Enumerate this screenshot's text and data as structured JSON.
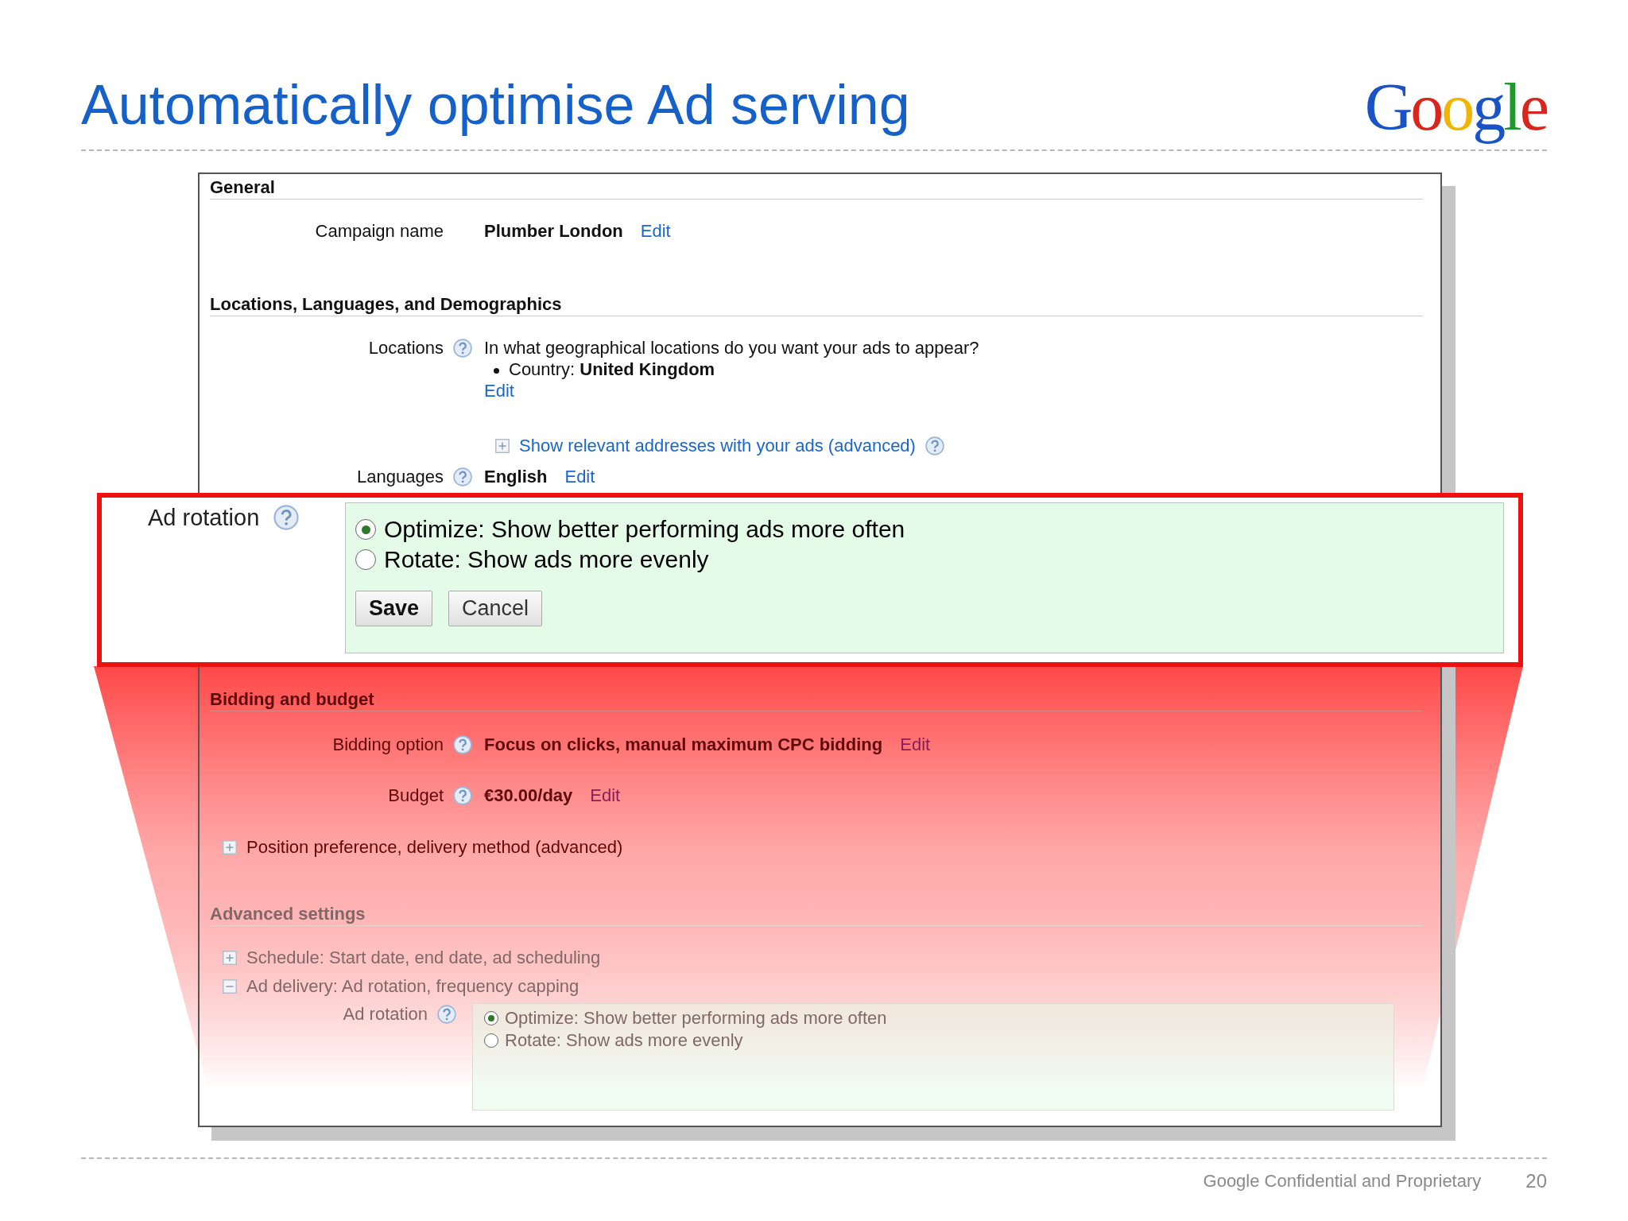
{
  "slide": {
    "title": "Automatically optimise Ad serving",
    "logo": "Google",
    "footer": "Google Confidential and Proprietary",
    "page_number": "20"
  },
  "sections": [
    {
      "heading": "General",
      "rows": [
        {
          "kind": "field",
          "label": "Campaign name",
          "help": false,
          "value": "Plumber London",
          "link": "Edit"
        }
      ]
    },
    {
      "heading": "Locations, Languages, and Demographics",
      "rows": [
        {
          "kind": "field",
          "label": "Locations",
          "help": true,
          "question": "In what geographical locations do you want your ads to appear?",
          "bullet_label": "Country:",
          "bullet_value": "United Kingdom",
          "link": "Edit"
        },
        {
          "kind": "expander",
          "text": "Show relevant addresses with your ads (advanced)",
          "linked": true,
          "expanded": false,
          "help": true
        },
        {
          "kind": "field",
          "label": "Languages",
          "help": true,
          "value": "English",
          "link": "Edit"
        }
      ]
    },
    {
      "heading": "Bidding and budget",
      "rows": [
        {
          "kind": "field",
          "label": "Bidding option",
          "help": true,
          "value": "Focus on clicks, manual maximum CPC bidding",
          "link": "Edit"
        },
        {
          "kind": "field",
          "label": "Budget",
          "help": true,
          "value": "€30.00/day",
          "link": "Edit"
        },
        {
          "kind": "expander",
          "text": "Position preference, delivery method (advanced)",
          "linked": false,
          "expanded": false,
          "help": false
        }
      ]
    },
    {
      "heading": "Advanced settings",
      "rows": [
        {
          "kind": "expander",
          "text": "Schedule: Start date, end date, ad scheduling",
          "linked": false,
          "expanded": false,
          "help": false
        },
        {
          "kind": "expander",
          "text": "Ad delivery: Ad rotation, frequency capping",
          "linked": false,
          "expanded": true,
          "help": false
        },
        {
          "kind": "options",
          "label": "Ad rotation",
          "help": true,
          "options": [
            {
              "label": "Optimize: Show better performing ads more often",
              "selected": true
            },
            {
              "label": "Rotate: Show ads more evenly",
              "selected": false
            }
          ]
        }
      ]
    }
  ],
  "highlight": {
    "label": "Ad rotation",
    "help": true,
    "options": [
      {
        "label": "Optimize: Show better performing ads more often",
        "selected": true
      },
      {
        "label": "Rotate: Show ads more evenly",
        "selected": false
      }
    ],
    "buttons": [
      "Save",
      "Cancel"
    ]
  }
}
